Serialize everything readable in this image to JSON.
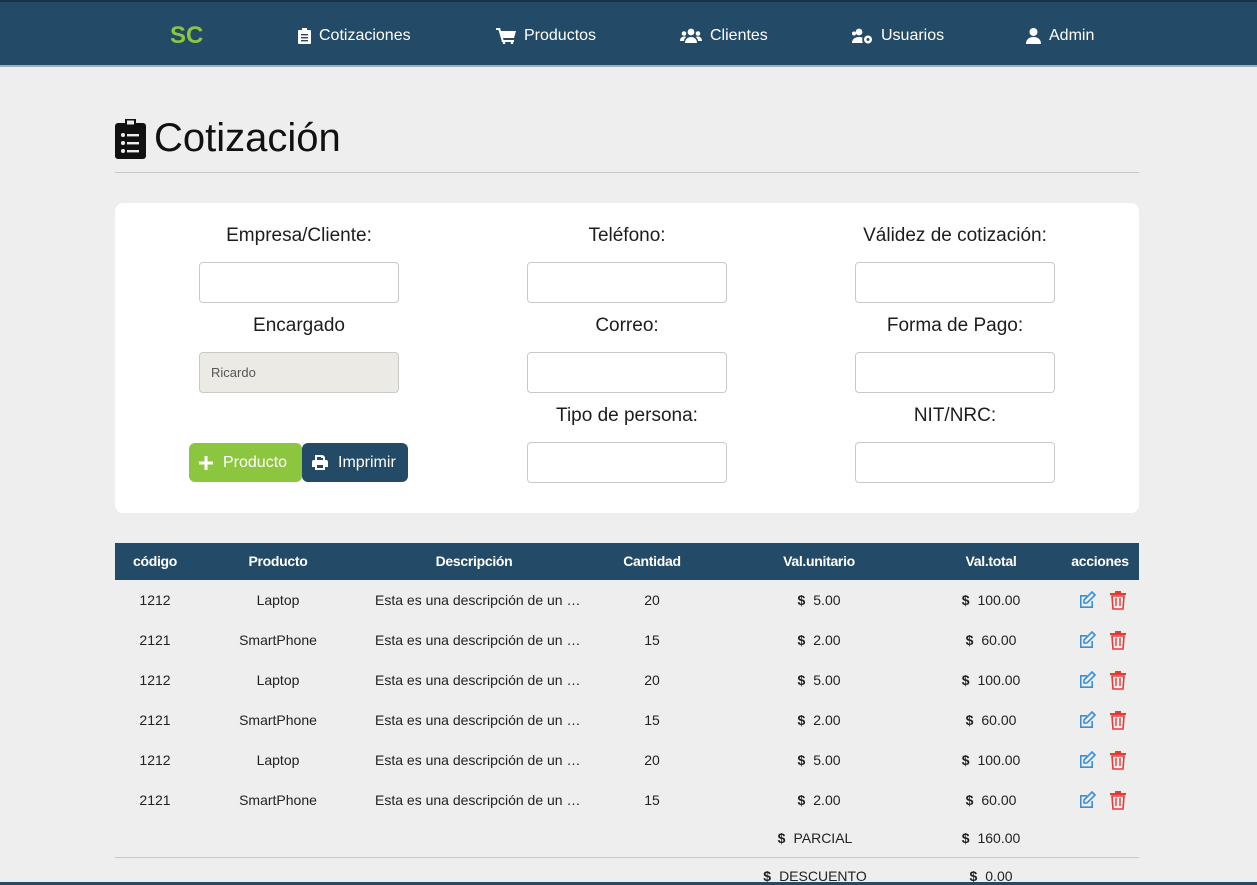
{
  "nav": {
    "brand": "SC",
    "items": [
      {
        "label": "Cotizaciones",
        "icon": "clipboard-list-icon"
      },
      {
        "label": "Productos",
        "icon": "shopping-cart-icon"
      },
      {
        "label": "Clientes",
        "icon": "users-icon"
      },
      {
        "label": "Usuarios",
        "icon": "users-cog-icon"
      },
      {
        "label": "Admin",
        "icon": "user-icon"
      }
    ]
  },
  "page": {
    "title": "Cotización"
  },
  "form": {
    "empresa_label": "Empresa/Cliente:",
    "empresa_value": "",
    "telefono_label": "Teléfono:",
    "telefono_value": "",
    "validez_label": "Válidez de cotización:",
    "validez_value": "",
    "encargado_label": "Encargado",
    "encargado_value": "Ricardo",
    "correo_label": "Correo:",
    "correo_value": "",
    "forma_pago_label": "Forma de Pago:",
    "forma_pago_value": "",
    "tipo_persona_label": "Tipo de persona:",
    "tipo_persona_value": "",
    "nit_label": "NIT/NRC:",
    "nit_value": "",
    "add_product_label": "Producto",
    "print_label": "Imprimir"
  },
  "table": {
    "headers": [
      "código",
      "Producto",
      "Descripción",
      "Cantidad",
      "Val.unitario",
      "Val.total",
      "acciones"
    ],
    "currency": "$",
    "rows": [
      {
        "codigo": "1212",
        "producto": "Laptop",
        "descripcion": "Esta es una descripción de un p...",
        "cantidad": "20",
        "unitario": "5.00",
        "total": "100.00"
      },
      {
        "codigo": "2121",
        "producto": "SmartPhone",
        "descripcion": "Esta es una descripción de un p...",
        "cantidad": "15",
        "unitario": "2.00",
        "total": "60.00"
      },
      {
        "codigo": "1212",
        "producto": "Laptop",
        "descripcion": "Esta es una descripción de un p...",
        "cantidad": "20",
        "unitario": "5.00",
        "total": "100.00"
      },
      {
        "codigo": "2121",
        "producto": "SmartPhone",
        "descripcion": "Esta es una descripción de un p...",
        "cantidad": "15",
        "unitario": "2.00",
        "total": "60.00"
      },
      {
        "codigo": "1212",
        "producto": "Laptop",
        "descripcion": "Esta es una descripción de un p...",
        "cantidad": "20",
        "unitario": "5.00",
        "total": "100.00"
      },
      {
        "codigo": "2121",
        "producto": "SmartPhone",
        "descripcion": "Esta es una descripción de un p...",
        "cantidad": "15",
        "unitario": "2.00",
        "total": "60.00"
      }
    ],
    "summary": [
      {
        "label": "PARCIAL",
        "value": "160.00"
      },
      {
        "label": "DESCUENTO",
        "value": "0.00"
      }
    ]
  },
  "colors": {
    "navy": "#234a66",
    "green": "#8cc63f",
    "edit": "#3a8fd9",
    "delete": "#e53935"
  }
}
